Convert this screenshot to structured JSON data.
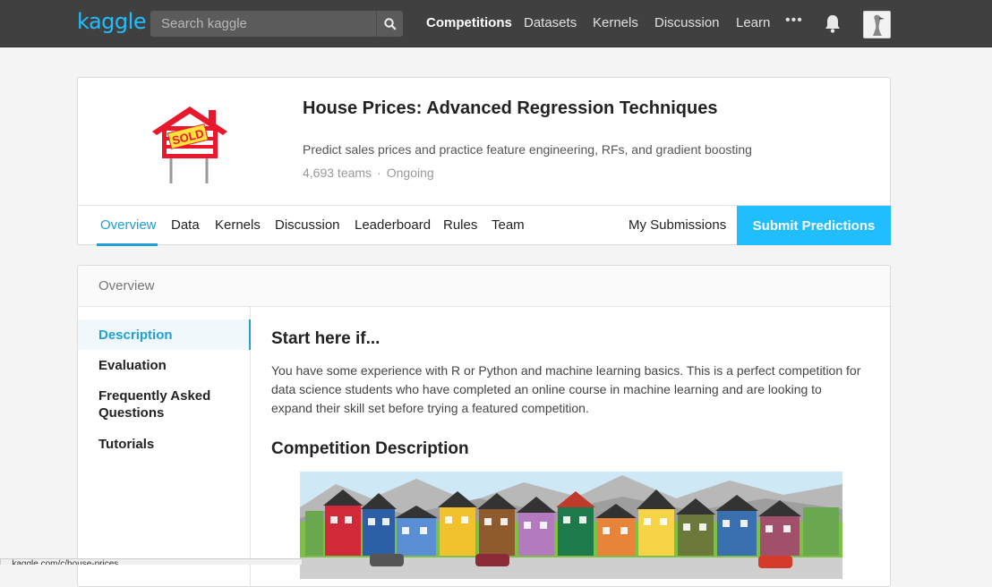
{
  "topbar": {
    "logo": "kaggle",
    "search_placeholder": "Search kaggle",
    "nav": [
      "Competitions",
      "Datasets",
      "Kernels",
      "Discussion",
      "Learn"
    ],
    "active_nav": "Competitions",
    "more": "•••"
  },
  "competition": {
    "title": "House Prices: Advanced Regression Techniques",
    "description": "Predict sales prices and practice feature engineering, RFs, and gradient boosting",
    "teams": "4,693 teams",
    "separator": "·",
    "status": "Ongoing",
    "logo_sign": "SOLD",
    "tabs": [
      "Overview",
      "Data",
      "Kernels",
      "Discussion",
      "Leaderboard",
      "Rules",
      "Team"
    ],
    "my_submissions": "My Submissions",
    "submit_label": "Submit Predictions"
  },
  "overview": {
    "heading": "Overview",
    "sidebar": [
      "Description",
      "Evaluation",
      "Frequently Asked Questions",
      "Tutorials"
    ],
    "start_heading": "Start here if...",
    "start_text": "You have some experience with R or Python and machine learning basics. This is a perfect competition for data science students who have completed an online course in machine learning and are looking to expand their skill set before trying a featured competition.",
    "desc_heading": "Competition Description"
  },
  "statusbar": {
    "text": "...kaggle.com/c/house-prices..."
  },
  "colors": {
    "accent": "#20beff",
    "topbar": "#404040",
    "link": "#20a0d8"
  }
}
